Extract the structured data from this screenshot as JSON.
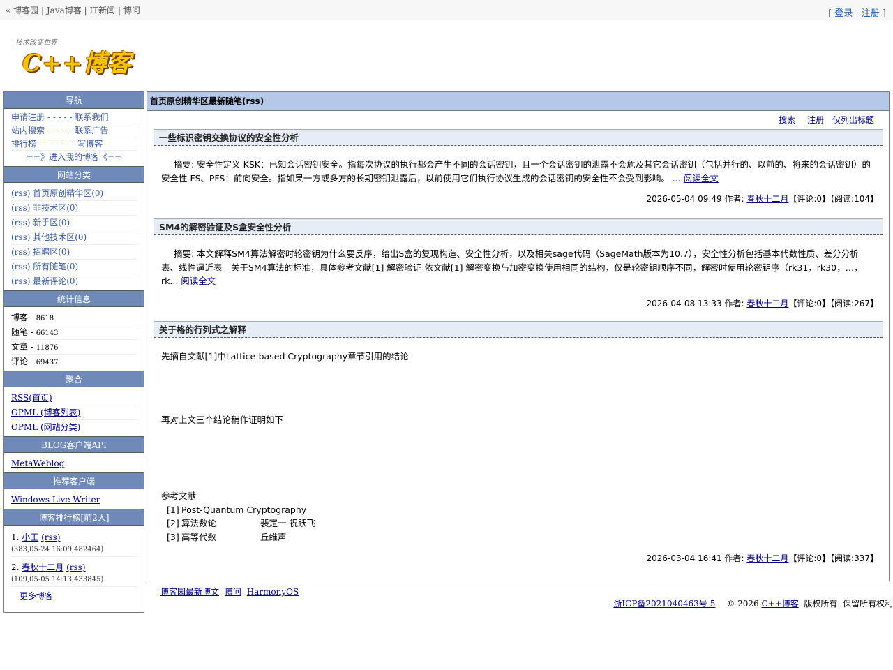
{
  "topbar": {
    "links_prefix": "« ",
    "links": [
      "博客园",
      "Java博客",
      "IT新闻",
      "博问"
    ],
    "login_open": "[ ",
    "login": "登录",
    "dot": " · ",
    "register": "注册",
    "login_close": " ]"
  },
  "logo": {
    "slogan": "技术改变世界",
    "text": "C++博客"
  },
  "sidebar": {
    "nav": {
      "title": "导航",
      "rows": [
        [
          "申请注册",
          "- - - - -",
          "联系我们"
        ],
        [
          "站内搜索",
          "- - - - -",
          "联系广告"
        ],
        [
          "排行榜",
          "- - - - - - -",
          "写博客"
        ]
      ],
      "enter": "==》进入我的博客《=="
    },
    "categories": {
      "title": "网站分类",
      "items": [
        "(rss) 首页原创精华区(0)",
        "(rss) 非技术区(0)",
        "(rss) 新手区(0)",
        "(rss) 其他技术区(0)",
        "(rss) 招聘区(0)",
        "(rss) 所有随笔(0)",
        "(rss) 最新评论(0)"
      ]
    },
    "stats": {
      "title": "统计信息",
      "items": [
        {
          "label": "博客 - ",
          "value": "8618"
        },
        {
          "label": "随笔 - ",
          "value": "66143"
        },
        {
          "label": "文章 - ",
          "value": "11876"
        },
        {
          "label": "评论 - ",
          "value": "69437"
        }
      ]
    },
    "aggregate": {
      "title": "聚合",
      "items": [
        "RSS(首页)",
        "OPML (博客列表)",
        "OPML (网站分类)"
      ]
    },
    "api": {
      "title": "BLOG客户端API",
      "items": [
        "MetaWeblog"
      ]
    },
    "client": {
      "title": "推荐客户端",
      "items": [
        "Windows Live Writer"
      ]
    },
    "rank": {
      "title": "博客排行榜[前2人]",
      "items": [
        {
          "num": "1. ",
          "name": "小王",
          "rss": "(rss)",
          "sub": "(383,05-24 16:09,482464)"
        },
        {
          "num": "2. ",
          "name": "春秋十二月",
          "rss": "(rss)",
          "sub": "(109,05-05 14:13,433845)"
        }
      ],
      "more": "更多博客"
    }
  },
  "main": {
    "title": "首页原创精华区最新随笔(rss)",
    "toolbar": [
      "搜索",
      "注册",
      "仅列出标题"
    ],
    "posts": [
      {
        "title": "一些标识密钥交换协议的安全性分析",
        "abstract": "摘要: 安全性定义   KSK：已知会话密钥安全。指每次协议的执行都会产生不同的会话密钥，且一个会话密钥的泄露不会危及其它会话密钥（包括并行的、以前的、将来的会话密钥）的安全性   FS、PFS：前向安全。指如果一方或多方的长期密钥泄露后，以前使用它们执行协议生成的会话密钥的安全性不会受到影响。            ...  ",
        "read_more": "阅读全文",
        "date": "2026-05-04 09:49 作者: ",
        "author": "春秋十二月",
        "stats": "【评论:0】【阅读:104】"
      },
      {
        "title": "SM4的解密验证及S盒安全性分析",
        "abstract": "摘要:  本文解释SM4算法解密时轮密钥为什么要反序，给出S盒的复现构造、安全性分析，以及相关sage代码（SageMath版本为10.7），安全性分析包括基本代数性质、差分分析表、线性逼近表。关于SM4算法的标准，具体参考文献[1] 解密验证  依文献[1] 解密变换与加密变换使用相同的结构，仅是轮密钥顺序不同，解密时使用轮密钥序（rk31，rk30，…，rk...  ",
        "read_more": "阅读全文",
        "date": "2026-04-08 13:33 作者: ",
        "author": "春秋十二月",
        "stats": "【评论:0】【阅读:267】"
      },
      {
        "title": "关于格的行列式之解释",
        "para1": "先摘自文献[1]中Lattice-based Cryptography章节引用的结论",
        "para2": "再对上文三个结论稍作证明如下",
        "refs_title": "参考文献",
        "refs": [
          {
            "num": "[1]",
            "title": "Post-Quantum Cryptography",
            "author": ""
          },
          {
            "num": "[2]",
            "title": "算法数论",
            "author": "裴定一 祝跃飞"
          },
          {
            "num": "[3]",
            "title": "高等代数",
            "author": "丘维声"
          }
        ],
        "date": "2026-03-04 16:41 作者: ",
        "author": "春秋十二月",
        "stats": "【评论:0】【阅读:337】"
      }
    ]
  },
  "footer": {
    "links": [
      "博客园最新博文",
      "博问",
      "HarmonyOS"
    ],
    "icp": "浙ICP备2021040463号-5",
    "copy_prefix": "© 2026 ",
    "site": "C++博客",
    "copy_suffix": ". 版权所有. 保留所有权利"
  }
}
